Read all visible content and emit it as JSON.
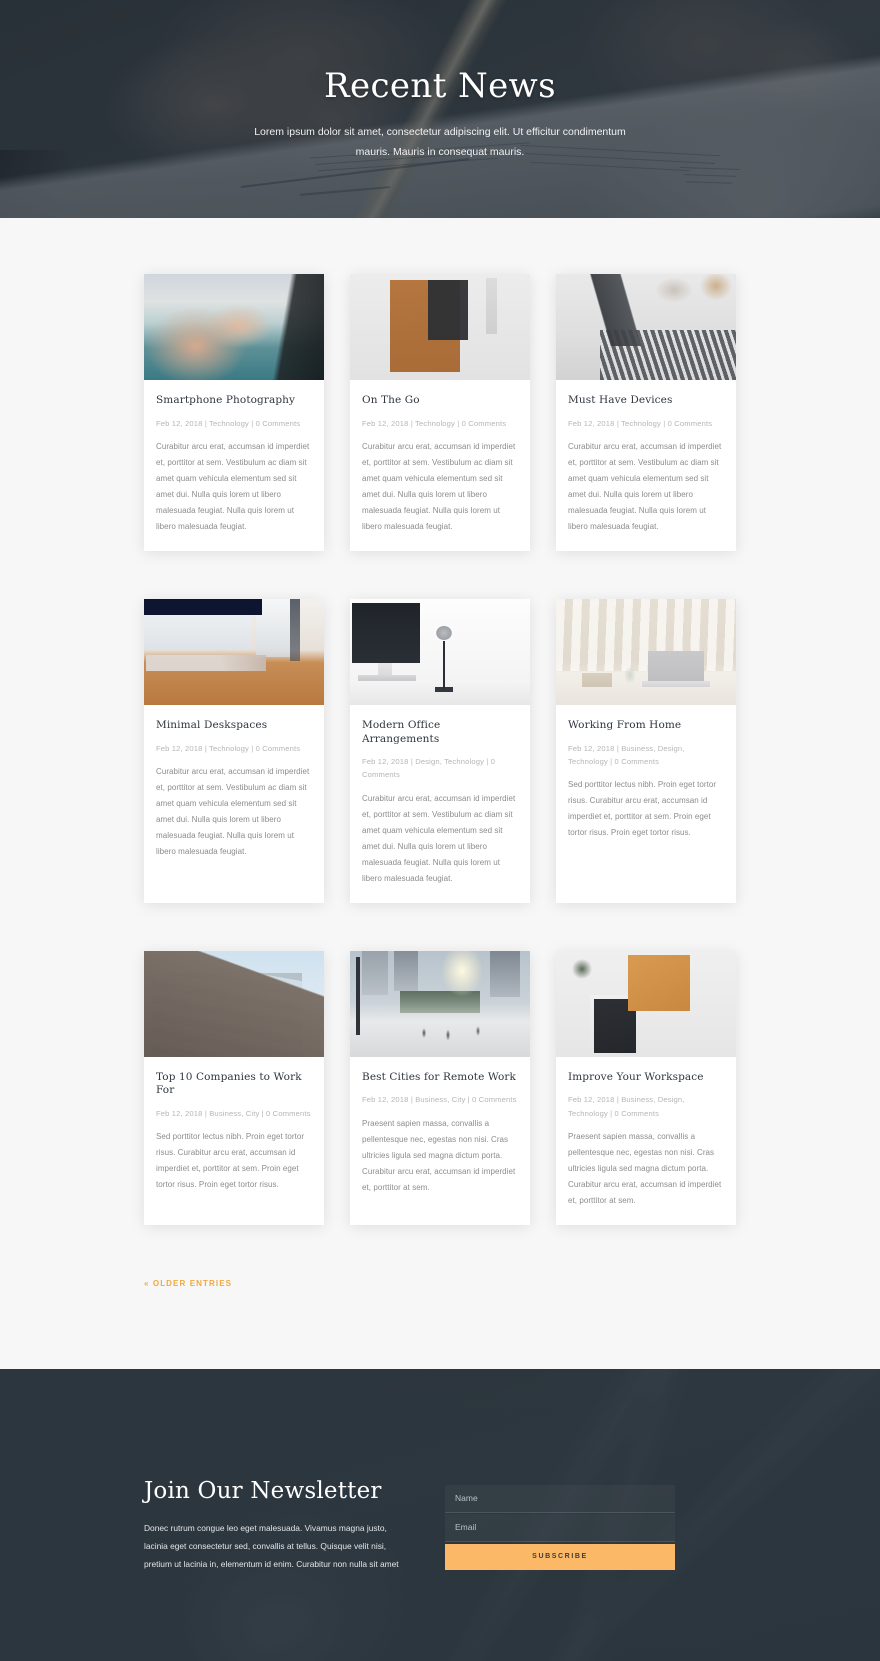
{
  "hero": {
    "title": "Recent News",
    "subtitle": "Lorem ipsum dolor sit amet, consectetur adipiscing elit. Ut efficitur condimentum mauris. Mauris in consequat mauris."
  },
  "blog": {
    "older_entries_label": "« Older Entries",
    "posts": [
      {
        "title": "Smartphone Photography",
        "meta": "Feb 12, 2018 | Technology | 0 Comments",
        "excerpt": "Curabitur arcu erat, accumsan id imperdiet et, porttitor at sem. Vestibulum ac diam sit amet quam vehicula elementum sed sit amet dui. Nulla quis lorem ut libero malesuada feugiat. Nulla quis lorem ut libero malesuada feugiat.",
        "image": "hands-holding-camera-at-mountain-lake"
      },
      {
        "title": "On The Go",
        "meta": "Feb 12, 2018 | Technology | 0 Comments",
        "excerpt": "Curabitur arcu erat, accumsan id imperdiet et, porttitor at sem. Vestibulum ac diam sit amet quam vehicula elementum sed sit amet dui. Nulla quis lorem ut libero malesuada feugiat. Nulla quis lorem ut libero malesuada feugiat.",
        "image": "phone-stylus-leather-case-and-watch-flatlay"
      },
      {
        "title": "Must Have Devices",
        "meta": "Feb 12, 2018 | Technology | 0 Comments",
        "excerpt": "Curabitur arcu erat, accumsan id imperdiet et, porttitor at sem. Vestibulum ac diam sit amet quam vehicula elementum sed sit amet dui. Nulla quis lorem ut libero malesuada feugiat. Nulla quis lorem ut libero malesuada feugiat.",
        "image": "open-laptop-keyboard-on-white-desk"
      },
      {
        "title": "Minimal Deskspaces",
        "meta": "Feb 12, 2018 | Technology | 0 Comments",
        "excerpt": "Curabitur arcu erat, accumsan id imperdiet et, porttitor at sem. Vestibulum ac diam sit amet quam vehicula elementum sed sit amet dui. Nulla quis lorem ut libero malesuada feugiat. Nulla quis lorem ut libero malesuada feugiat.",
        "image": "wireless-keyboard-on-wooden-desk-by-window"
      },
      {
        "title": "Modern Office Arrangements",
        "meta": "Feb 12, 2018 | Design, Technology | 0 Comments",
        "excerpt": "Curabitur arcu erat, accumsan id imperdiet et, porttitor at sem. Vestibulum ac diam sit amet quam vehicula elementum sed sit amet dui. Nulla quis lorem ut libero malesuada feugiat. Nulla quis lorem ut libero malesuada feugiat.",
        "image": "desktop-monitor-and-desk-lamp-on-white-wall"
      },
      {
        "title": "Working From Home",
        "meta": "Feb 12, 2018 | Business, Design, Technology | 0 Comments",
        "excerpt": "Sed porttitor lectus nibh. Proin eget tortor risus. Curabitur arcu erat, accumsan id imperdiet et, porttitor at sem. Proin eget tortor risus. Proin eget tortor risus.",
        "image": "laptop-on-white-table-with-curtains"
      },
      {
        "title": "Top 10 Companies to Work For",
        "meta": "Feb 12, 2018 | Business, City | 0 Comments",
        "excerpt": "Sed porttitor lectus nibh. Proin eget tortor risus. Curabitur arcu erat, accumsan id imperdiet et, porttitor at sem. Proin eget tortor risus. Proin eget tortor risus.",
        "image": "ornate-stone-building-corner-against-blue-sky"
      },
      {
        "title": "Best Cities for Remote Work",
        "meta": "Feb 12, 2018 | Business, City | 0 Comments",
        "excerpt": "Praesent sapien massa, convallis a pellentesque nec, egestas non nisi. Cras ultricies ligula sed magna dictum porta. Curabitur arcu erat, accumsan id imperdiet et, porttitor at sem.",
        "image": "city-street-with-pedestrians-at-sunset"
      },
      {
        "title": "Improve Your Workspace",
        "meta": "Feb 12, 2018 | Business, Design, Technology | 0 Comments",
        "excerpt": "Praesent sapien massa, convallis a pellentesque nec, egestas non nisi. Cras ultricies ligula sed magna dictum porta. Curabitur arcu erat, accumsan id imperdiet et, porttitor at sem.",
        "image": "headphones-tablet-and-plant-flatlay"
      }
    ]
  },
  "newsletter": {
    "title": "Join Our Newsletter",
    "copy": "Donec rutrum congue leo eget malesuada. Vivamus magna justo, lacinia eget consectetur sed, convallis at tellus. Quisque velit nisi, pretium ut lacinia in, elementum id enim. Curabitur non nulla sit amet",
    "name_placeholder": "Name",
    "name_value": "",
    "email_placeholder": "Email",
    "email_value": "",
    "subscribe_label": "SUBSCRIBE"
  },
  "colors": {
    "accent": "#fbb867",
    "link": "#f0a93c",
    "dark": "#2c3740",
    "page_bg": "#f7f7f7"
  }
}
